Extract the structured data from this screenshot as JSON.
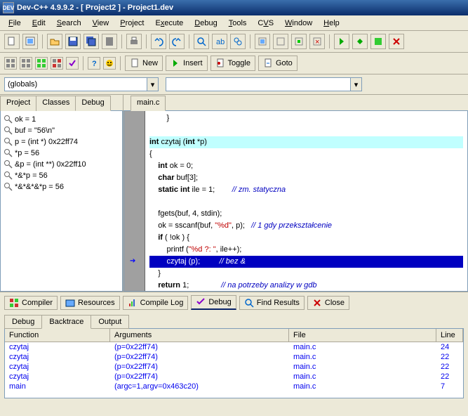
{
  "title": "Dev-C++ 4.9.9.2  -  [ Project2 ] - Project1.dev",
  "menus": [
    "File",
    "Edit",
    "Search",
    "View",
    "Project",
    "Execute",
    "Debug",
    "Tools",
    "CVS",
    "Window",
    "Help"
  ],
  "toolbar2": {
    "new": "New",
    "insert": "Insert",
    "toggle": "Toggle",
    "goto": "Goto"
  },
  "globals": "(globals)",
  "leftTabs": [
    "Project",
    "Classes",
    "Debug"
  ],
  "leftActive": 2,
  "watches": [
    "ok = 1",
    "buf = \"56\\n\"",
    "p = (int *) 0x22ff74",
    "*p = 56",
    "&p = (int **) 0x22ff10",
    "*&*p = 56",
    "*&*&*&*p = 56"
  ],
  "editorTab": "main.c",
  "codeLines": [
    {
      "t": "        }"
    },
    {
      "t": ""
    },
    {
      "t": "int czytaj (int *p)",
      "hlc": true,
      "sig": [
        [
          0,
          3
        ],
        [
          12,
          21
        ]
      ]
    },
    {
      "t": "{"
    },
    {
      "t": "    int ok = 0;",
      "kw": [
        [
          4,
          7
        ]
      ]
    },
    {
      "t": "    char buf[3];",
      "kw": [
        [
          4,
          8
        ]
      ]
    },
    {
      "t": "    static int ile = 1;        // zm. statyczna",
      "kw": [
        [
          4,
          14
        ]
      ],
      "cmt": 27
    },
    {
      "t": ""
    },
    {
      "t": "    fgets(buf, 4, stdin);"
    },
    {
      "t": "    ok = sscanf(buf, \"%d\", p);   // 1 gdy przekształcenie",
      "str": [
        [
          21,
          25
        ]
      ],
      "cmt": 33
    },
    {
      "t": "    if ( !ok ) {",
      "kw": [
        [
          4,
          6
        ]
      ]
    },
    {
      "t": "        printf (\"%d ?: \", ile++);",
      "str": [
        [
          16,
          24
        ]
      ]
    },
    {
      "t": "        czytaj (p);         // bez &",
      "hlb": true,
      "cmt": 28,
      "mark": true
    },
    {
      "t": "    }"
    },
    {
      "t": "    return 1;               // na potrzeby analizy w gdb",
      "kw": [
        [
          4,
          10
        ]
      ],
      "cmt": 28
    },
    {
      "t": "}"
    }
  ],
  "bottomTabs": [
    "Compiler",
    "Resources",
    "Compile Log",
    "Debug",
    "Find Results",
    "Close"
  ],
  "bottomActive": 3,
  "subTabs": [
    "Debug",
    "Backtrace",
    "Output"
  ],
  "subActive": 1,
  "btHeaders": [
    "Function",
    "Arguments",
    "File",
    "Line"
  ],
  "btRows": [
    {
      "func": "czytaj",
      "args": "(p=0x22ff74)",
      "file": "main.c",
      "line": "24"
    },
    {
      "func": "czytaj",
      "args": "(p=0x22ff74)",
      "file": "main.c",
      "line": "22"
    },
    {
      "func": "czytaj",
      "args": "(p=0x22ff74)",
      "file": "main.c",
      "line": "22"
    },
    {
      "func": "czytaj",
      "args": "(p=0x22ff74)",
      "file": "main.c",
      "line": "22"
    },
    {
      "func": "main",
      "args": "(argc=1,argv=0x463c20)",
      "file": "main.c",
      "line": "7"
    }
  ]
}
